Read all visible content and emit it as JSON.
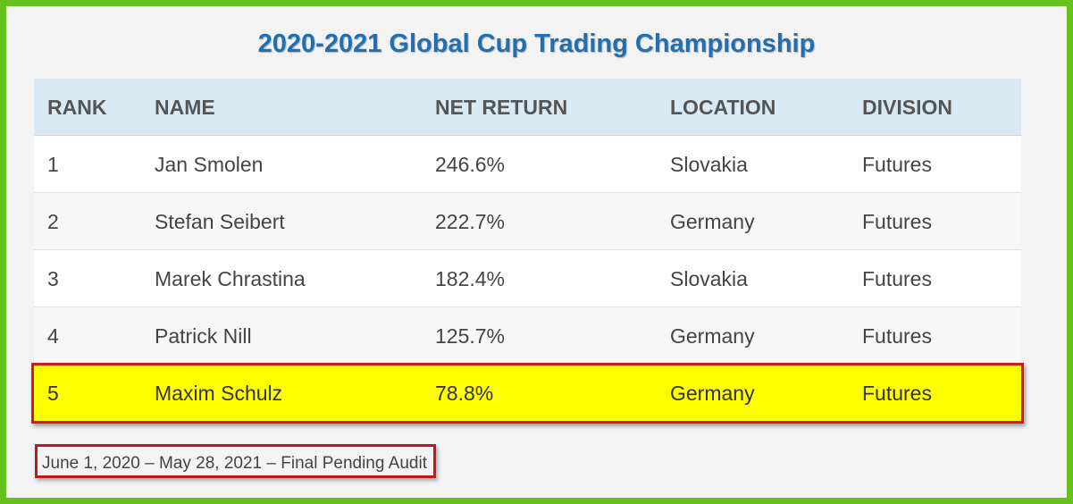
{
  "title": "2020-2021 Global Cup Trading Championship",
  "table": {
    "headers": [
      "RANK",
      "NAME",
      "NET RETURN",
      "LOCATION",
      "DIVISION"
    ],
    "rows": [
      {
        "rank": "1",
        "name": "Jan Smolen",
        "net_return": "246.6%",
        "location": "Slovakia",
        "division": "Futures"
      },
      {
        "rank": "2",
        "name": "Stefan Seibert",
        "net_return": "222.7%",
        "location": "Germany",
        "division": "Futures"
      },
      {
        "rank": "3",
        "name": "Marek Chrastina",
        "net_return": "182.4%",
        "location": "Slovakia",
        "division": "Futures"
      },
      {
        "rank": "4",
        "name": "Patrick Nill",
        "net_return": "125.7%",
        "location": "Germany",
        "division": "Futures"
      },
      {
        "rank": "5",
        "name": "Maxim Schulz",
        "net_return": "78.8%",
        "location": "Germany",
        "division": "Futures"
      }
    ]
  },
  "footnote": "June 1, 2020 – May 28, 2021 – Final Pending Audit",
  "colors": {
    "frame_border": "#66c21a",
    "title": "#1f6fb2",
    "header_bg": "#d9eaf5",
    "highlight_bg": "#ffff00",
    "highlight_border": "#d11a1a"
  }
}
